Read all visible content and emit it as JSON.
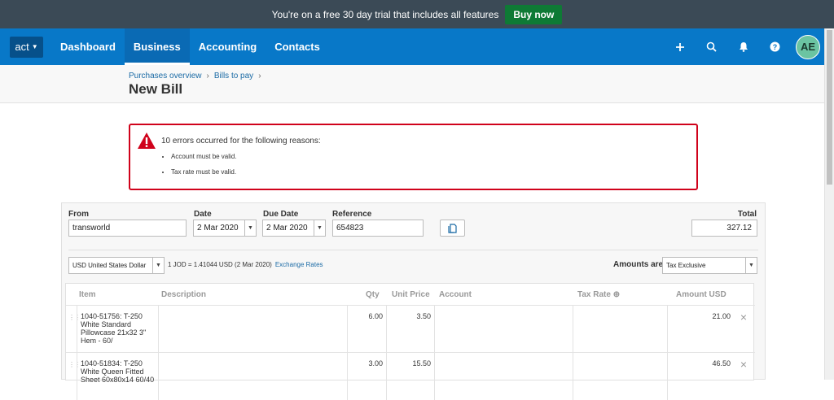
{
  "trial": {
    "text": "You're on a free 30 day trial that includes all features",
    "buy_label": "Buy now"
  },
  "nav": {
    "org_label": "act",
    "items": [
      {
        "label": "Dashboard",
        "active": false
      },
      {
        "label": "Business",
        "active": true
      },
      {
        "label": "Accounting",
        "active": false
      },
      {
        "label": "Contacts",
        "active": false
      }
    ],
    "icons": [
      "plus-icon",
      "search-icon",
      "bell-icon",
      "help-icon"
    ],
    "avatar_initials": "AE"
  },
  "breadcrumb": [
    "Purchases overview",
    "Bills to pay"
  ],
  "page_title": "New Bill",
  "errors": {
    "title": "10 errors occurred for the following reasons:",
    "items": [
      "Account must be valid.",
      "Tax rate must be valid."
    ]
  },
  "form": {
    "from_label": "From",
    "from_value": "transworld",
    "date_label": "Date",
    "date_value": "2 Mar 2020",
    "due_label": "Due Date",
    "due_value": "2 Mar 2020",
    "ref_label": "Reference",
    "ref_value": "654823",
    "total_label": "Total",
    "total_value": "327.12",
    "currency_value": "USD United States Dollar",
    "rate_text": "1 JOD = 1.41044  USD  (2 Mar 2020)",
    "exchange_link": "Exchange Rates",
    "amounts_label": "Amounts are",
    "amounts_value": "Tax Exclusive"
  },
  "grid": {
    "headers": {
      "item": "Item",
      "description": "Description",
      "qty": "Qty",
      "unit_price": "Unit Price",
      "account": "Account",
      "tax_rate": "Tax Rate",
      "amount": "Amount USD"
    },
    "rows": [
      {
        "item": "1040-51756: T-250 White Standard Pillowcase 21x32 3\" Hem - 60/",
        "description": "",
        "qty": "6.00",
        "unit_price": "3.50",
        "account": "",
        "tax_rate": "",
        "amount": "21.00"
      },
      {
        "item": "1040-51834: T-250 White Queen Fitted Sheet 60x80x14 60/40",
        "description": "",
        "qty": "3.00",
        "unit_price": "15.50",
        "account": "",
        "tax_rate": "",
        "amount": "46.50"
      }
    ]
  },
  "colors": {
    "nav": "#0878c8",
    "trial_bar": "#3b4a56",
    "buy": "#0e7a35",
    "error": "#d0021b"
  }
}
